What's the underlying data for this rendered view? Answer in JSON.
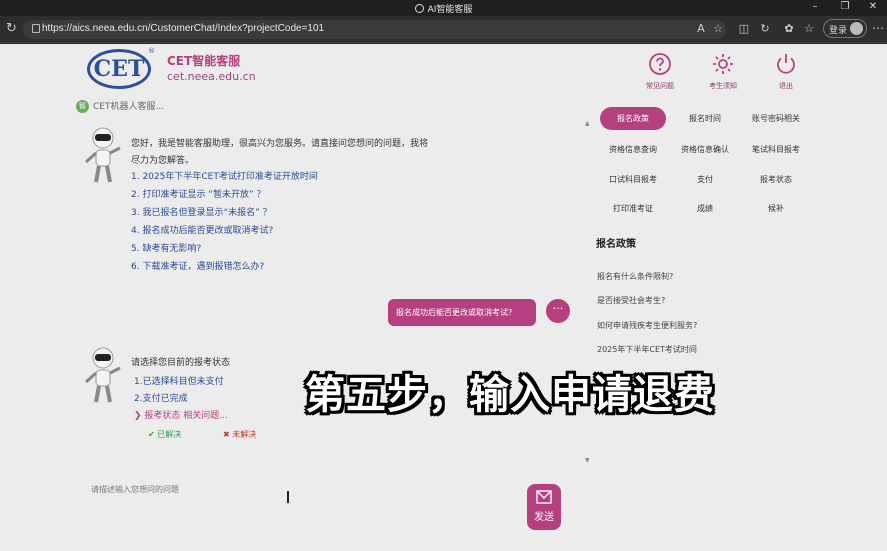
{
  "browser": {
    "window_title": "AI智能客服",
    "url": "https://aics.neea.edu.cn/CustomerChat/Index?projectCode=101",
    "login_label": "登录"
  },
  "header": {
    "logo_text": "CET",
    "brand_name": "CET智能客服",
    "domain": "cet.neea.edu.cn",
    "buttons": [
      {
        "label": "常见问题",
        "icon": "question-icon"
      },
      {
        "label": "考生须知",
        "icon": "gear-icon"
      },
      {
        "label": "退出",
        "icon": "power-icon"
      }
    ]
  },
  "chat": {
    "bot_status": "CET机器人客服...",
    "bot_dot": "智",
    "welcome_line1": "您好，我是智能客服助理，很高兴为您服务。请直接问您想问的问题，我将",
    "welcome_line2": "尽力为您解答。",
    "questions": [
      "1. 2025年下半年CET考试打印准考证开放时间",
      "2. 打印准考证显示 “暂未开放” ？",
      "3. 我已报名但登录显示“未报名” ？",
      "4. 报名成功后能否更改或取消考试?",
      "5. 缺考有无影响?",
      "6. 下载准考证，遇到报错怎么办?"
    ],
    "user_message": "报名成功后能否更改或取消考试?",
    "user_avatar_glyph": "···",
    "reply_prompt": "请选择您目前的报考状态",
    "reply_options": [
      "1.已选择科目但未支付",
      "2.支付已完成"
    ],
    "reply_more": "报考状态 相关问题...",
    "feedback_yes": "已解决",
    "feedback_no": "未解决"
  },
  "sidebar": {
    "categories": [
      [
        "报名政策",
        "报名时间",
        "账号密码相关"
      ],
      [
        "资格信息查询",
        "资格信息确认",
        "笔试科目报考"
      ],
      [
        "口试科目报考",
        "支付",
        "报考状态"
      ],
      [
        "打印准考证",
        "成绩",
        "候补"
      ]
    ],
    "active_category": "报名政策",
    "section_title": "报名政策",
    "links": [
      "报名有什么条件限制?",
      "是否接受社会考生?",
      "如何申请残疾考生便利服务?",
      "2025年下半年CET考试时间"
    ]
  },
  "input": {
    "placeholder": "请描述输入您想问的问题",
    "send_label": "发送"
  },
  "overlay_caption": "第五步，输入申请退费",
  "colors": {
    "accent": "#b6407f",
    "link": "#2a4a99",
    "logo": "#2b4f9c"
  }
}
